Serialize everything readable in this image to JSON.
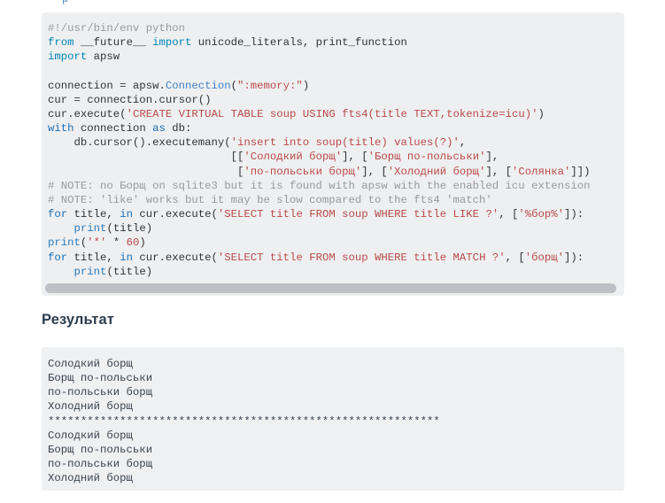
{
  "document": {
    "clipped_top_fragment": "p",
    "result_heading": "Результат"
  },
  "code_block": {
    "language": "python",
    "background_color": "#eeeff1",
    "scrollbar": {
      "orientation": "horizontal",
      "thumb_color": "#bdc0c4"
    },
    "colors": {
      "comment": "#999999",
      "keyword": "#0086b3",
      "keyword_alt": "#1a6fb5",
      "class_name": "#4183c4",
      "string": "#b94a48",
      "number": "#b94a48",
      "builtin": "#2b7bb9",
      "plain": "#333333"
    },
    "lines": [
      [
        {
          "t": "#!/usr/bin/env python",
          "c": "com"
        }
      ],
      [
        {
          "t": "from",
          "c": "kw"
        },
        {
          "t": " __future__ ",
          "c": "pl"
        },
        {
          "t": "import",
          "c": "kw"
        },
        {
          "t": " unicode_literals, print_function",
          "c": "pl"
        }
      ],
      [
        {
          "t": "import",
          "c": "kw"
        },
        {
          "t": " apsw",
          "c": "pl"
        }
      ],
      [
        {
          "t": "",
          "c": "pl"
        }
      ],
      [
        {
          "t": "connection = apsw.",
          "c": "pl"
        },
        {
          "t": "Connection",
          "c": "cls"
        },
        {
          "t": "(",
          "c": "pl"
        },
        {
          "t": "\":memory:\"",
          "c": "str"
        },
        {
          "t": ")",
          "c": "pl"
        }
      ],
      [
        {
          "t": "cur = connection.cursor()",
          "c": "pl"
        }
      ],
      [
        {
          "t": "cur.execute(",
          "c": "pl"
        },
        {
          "t": "'CREATE VIRTUAL TABLE soup USING fts4(title TEXT,tokenize=icu)'",
          "c": "str"
        },
        {
          "t": ")",
          "c": "pl"
        }
      ],
      [
        {
          "t": "with",
          "c": "kw2"
        },
        {
          "t": " connection ",
          "c": "pl"
        },
        {
          "t": "as",
          "c": "kw2"
        },
        {
          "t": " db:",
          "c": "pl"
        }
      ],
      [
        {
          "t": "    db.cursor().executemany(",
          "c": "pl"
        },
        {
          "t": "'insert into soup(title) values(?)'",
          "c": "str"
        },
        {
          "t": ",",
          "c": "pl"
        }
      ],
      [
        {
          "t": "                            [[",
          "c": "pl"
        },
        {
          "t": "'Солодкий борщ'",
          "c": "str"
        },
        {
          "t": "], [",
          "c": "pl"
        },
        {
          "t": "'Борщ по-польськи'",
          "c": "str"
        },
        {
          "t": "],",
          "c": "pl"
        }
      ],
      [
        {
          "t": "                             [",
          "c": "pl"
        },
        {
          "t": "'по-польськи борщ'",
          "c": "str"
        },
        {
          "t": "], [",
          "c": "pl"
        },
        {
          "t": "'Холодний борщ'",
          "c": "str"
        },
        {
          "t": "], [",
          "c": "pl"
        },
        {
          "t": "'Солянка'",
          "c": "str"
        },
        {
          "t": "]])",
          "c": "pl"
        }
      ],
      [
        {
          "t": "# NOTE: no Борщ on sqlite3 but it is found with apsw with the enabled icu extension",
          "c": "com"
        }
      ],
      [
        {
          "t": "# NOTE: 'like' works but it may be slow compared to the fts4 'match'",
          "c": "com"
        }
      ],
      [
        {
          "t": "for",
          "c": "kw2"
        },
        {
          "t": " title, ",
          "c": "pl"
        },
        {
          "t": "in",
          "c": "kw2"
        },
        {
          "t": " cur.execute(",
          "c": "pl"
        },
        {
          "t": "'SELECT title FROM soup WHERE title LIKE ?'",
          "c": "str"
        },
        {
          "t": ", [",
          "c": "pl"
        },
        {
          "t": "'%бор%'",
          "c": "str"
        },
        {
          "t": "]):",
          "c": "pl"
        }
      ],
      [
        {
          "t": "    ",
          "c": "pl"
        },
        {
          "t": "print",
          "c": "bi"
        },
        {
          "t": "(title)",
          "c": "pl"
        }
      ],
      [
        {
          "t": "print",
          "c": "bi"
        },
        {
          "t": "(",
          "c": "pl"
        },
        {
          "t": "'*'",
          "c": "str"
        },
        {
          "t": " * ",
          "c": "pl"
        },
        {
          "t": "60",
          "c": "num"
        },
        {
          "t": ")",
          "c": "pl"
        }
      ],
      [
        {
          "t": "for",
          "c": "kw2"
        },
        {
          "t": " title, ",
          "c": "pl"
        },
        {
          "t": "in",
          "c": "kw2"
        },
        {
          "t": " cur.execute(",
          "c": "pl"
        },
        {
          "t": "'SELECT title FROM soup WHERE title MATCH ?'",
          "c": "str"
        },
        {
          "t": ", [",
          "c": "pl"
        },
        {
          "t": "'борщ'",
          "c": "str"
        },
        {
          "t": "]):",
          "c": "pl"
        }
      ],
      [
        {
          "t": "    ",
          "c": "pl"
        },
        {
          "t": "print",
          "c": "bi"
        },
        {
          "t": "(title)",
          "c": "pl"
        }
      ]
    ]
  },
  "output_block": {
    "background_color": "#eef0f2",
    "text_color": "#3b4350",
    "lines": [
      "Солодкий борщ",
      "Борщ по-польськи",
      "по-польськи борщ",
      "Холодний борщ",
      "************************************************************",
      "Солодкий борщ",
      "Борщ по-польськи",
      "по-польськи борщ",
      "Холодний борщ"
    ]
  }
}
